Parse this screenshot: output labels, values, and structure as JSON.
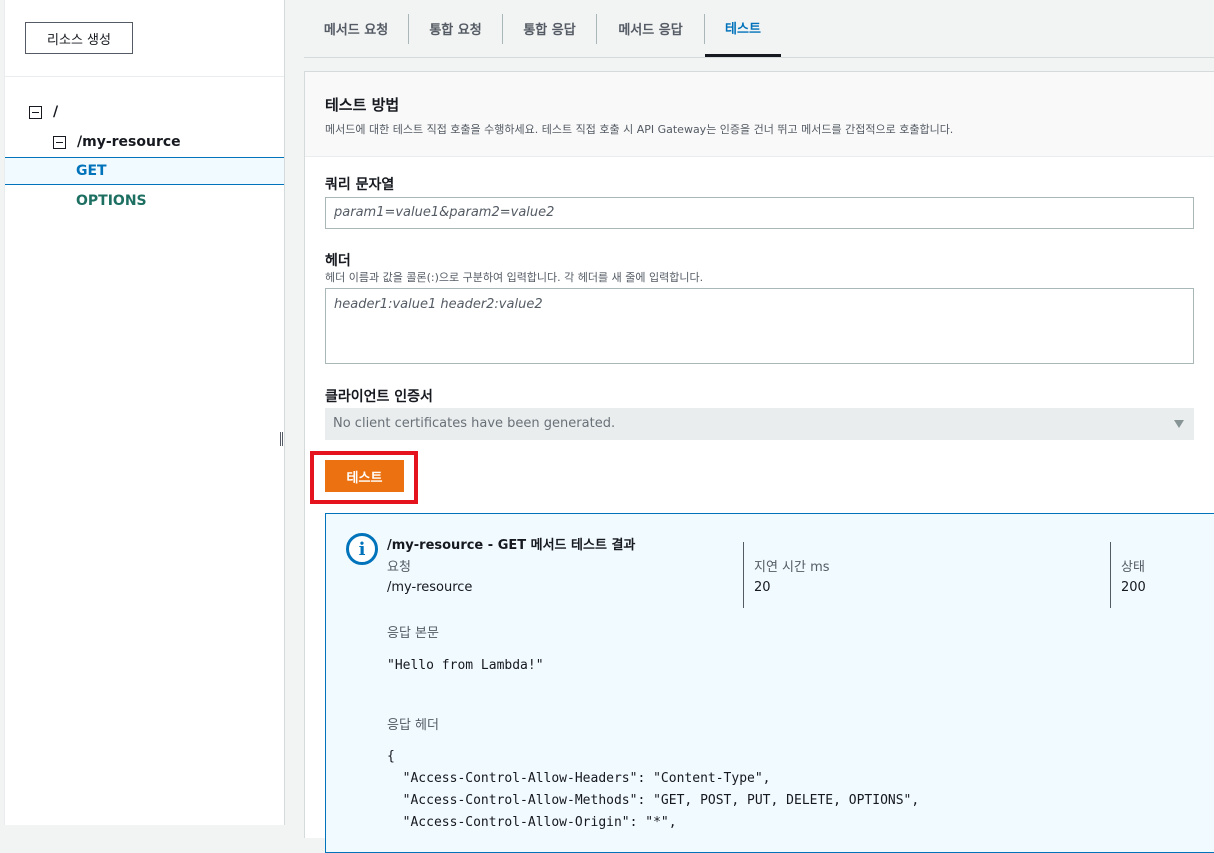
{
  "sidebar": {
    "create_button": "리소스 생성",
    "tree": {
      "root": "/",
      "resource": "/my-resource",
      "methods": [
        "GET",
        "OPTIONS"
      ]
    }
  },
  "tabs": [
    "메서드 요청",
    "통합 요청",
    "통합 응답",
    "메서드 응답",
    "테스트"
  ],
  "active_tab": "테스트",
  "test": {
    "title": "테스트 방법",
    "description": "메서드에 대한 테스트 직접 호출을 수행하세요. 테스트 직접 호출 시 API Gateway는 인증을 건너 뛰고 메서드를 간접적으로 호출합니다.",
    "query_label": "쿼리 문자열",
    "query_placeholder": "param1=value1&param2=value2",
    "headers_label": "헤더",
    "headers_desc": "헤더 이름과 값을 콜론(:)으로 구분하여 입력합니다. 각 헤더를 새 줄에 입력합니다.",
    "headers_placeholder": "header1:value1 header2:value2",
    "cert_label": "클라이언트 인증서",
    "cert_value": "No client certificates have been generated.",
    "test_button": "테스트"
  },
  "result": {
    "title": "/my-resource - GET 메서드 테스트 결과",
    "request_label": "요청",
    "request_value": "/my-resource",
    "latency_label": "지연 시간 ms",
    "latency_value": "20",
    "status_label": "상태",
    "status_value": "200",
    "body_label": "응답 본문",
    "body_value": "\"Hello from Lambda!\"",
    "headers_label": "응답 헤더",
    "headers_lines": [
      "{",
      "  \"Access-Control-Allow-Headers\": \"Content-Type\",",
      "  \"Access-Control-Allow-Methods\": \"GET, POST, PUT, DELETE, OPTIONS\",",
      "  \"Access-Control-Allow-Origin\": \"*\","
    ]
  },
  "colors": {
    "accent": "#0073bb",
    "button": "#ec7211",
    "highlight": "#e5131e"
  }
}
